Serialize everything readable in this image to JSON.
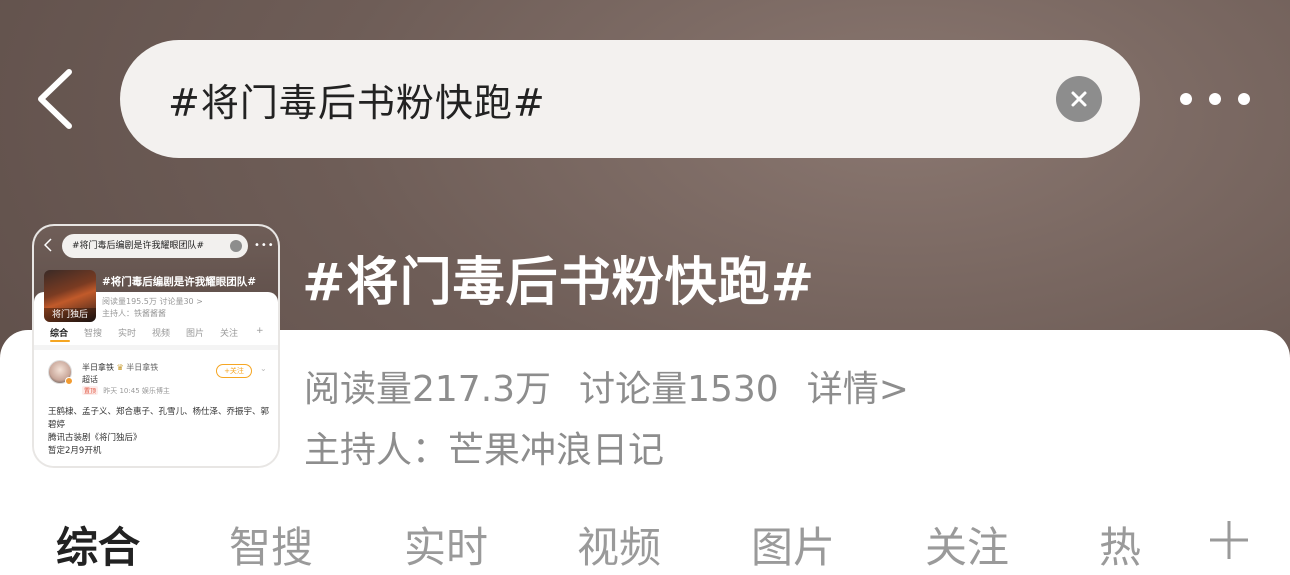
{
  "header": {
    "back_icon": "chevron-left-icon",
    "search_value": "#将门毒后书粉快跑#",
    "clear_icon": "close-circle-icon",
    "more_icon": "more-dots-icon"
  },
  "topic": {
    "title": "#将门毒后书粉快跑#",
    "read_count": "阅读量217.3万",
    "discussion_count": "讨论量1530",
    "details_link": "详情>",
    "host": "主持人：芒果冲浪日记"
  },
  "tabs": [
    {
      "label": "综合",
      "active": true
    },
    {
      "label": "智搜",
      "active": false
    },
    {
      "label": "实时",
      "active": false
    },
    {
      "label": "视频",
      "active": false
    },
    {
      "label": "图片",
      "active": false
    },
    {
      "label": "关注",
      "active": false
    },
    {
      "label": "热",
      "active": false
    }
  ],
  "tab_add_icon": "plus-icon",
  "thumbnail": {
    "search_value": "#将门毒后编剧是许我耀眼团队#",
    "title": "#将门毒后编剧是许我耀眼团队#",
    "poster_label": "将门独后",
    "stats": "阅读量195.5万  讨论量30  >",
    "host": "主持人：铁酱酱酱",
    "tabs": [
      "综合",
      "智搜",
      "实时",
      "视频",
      "图片",
      "关注",
      "+"
    ],
    "post": {
      "user": "半日拿铁",
      "user_secondary": "半日拿铁",
      "subtitle": "超话",
      "tag": "置顶",
      "meta": "昨天 10:45  娱乐博主",
      "follow_label": "+关注",
      "body_line1": "王鹤棣、孟子义、郑合惠子、孔雪儿、杨仕泽、乔振宇、郭碧婷",
      "body_line2": "腾讯古装剧《将门独后》",
      "body_line3": "暂定2月9开机"
    }
  },
  "colors": {
    "header_bg": "#6e5d57",
    "accent": "#f5a623",
    "text_primary": "#222222",
    "text_secondary": "#8d8d8d"
  }
}
